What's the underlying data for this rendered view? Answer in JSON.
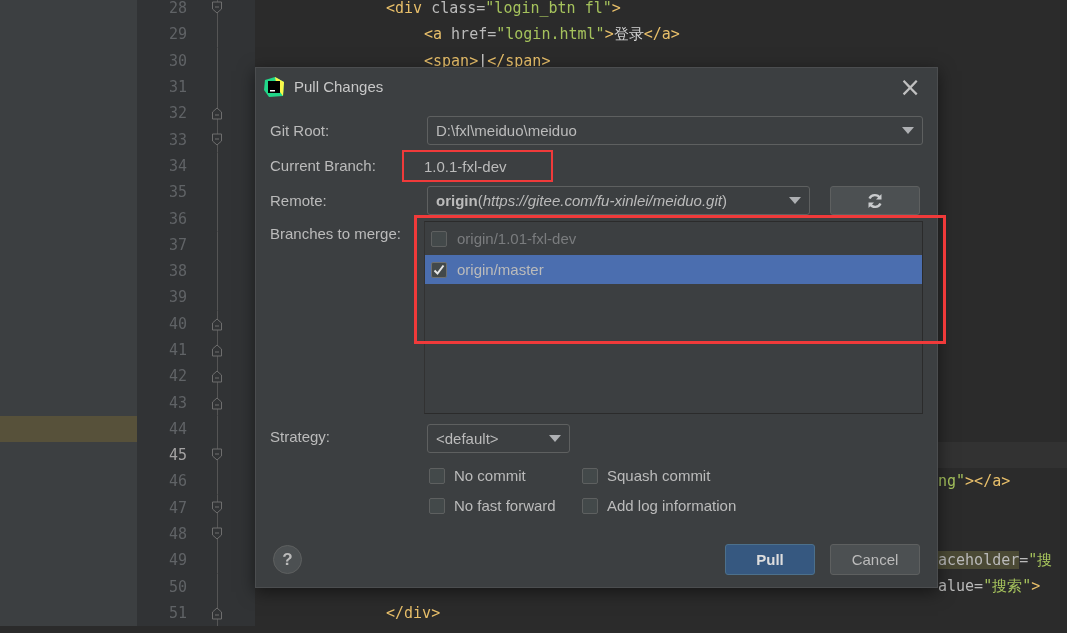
{
  "editor": {
    "lines": [
      {
        "number": "28",
        "kind": "fold-start",
        "current": false,
        "side_highlight": false,
        "segments": [
          {
            "kind": "tag",
            "text": "<div"
          },
          {
            "kind": "attr",
            "text": " class="
          },
          {
            "kind": "string",
            "text": "\"login_btn fl\""
          },
          {
            "kind": "tag",
            "text": ">"
          }
        ],
        "children": [
          {
            "number": "29",
            "current": false,
            "side_highlight": false,
            "segments": [
              {
                "kind": "tag",
                "text": "<a"
              },
              {
                "kind": "attr",
                "text": " href="
              },
              {
                "kind": "string",
                "text": "\"login.html\""
              },
              {
                "kind": "tag",
                "text": ">"
              },
              {
                "kind": "plain",
                "text": "登录"
              },
              {
                "kind": "tag",
                "text": "</a>"
              }
            ]
          },
          {
            "number": "30",
            "current": false,
            "side_highlight": false,
            "segments": [
              {
                "kind": "tag",
                "text": "<span>"
              },
              {
                "kind": "plain",
                "text": "|"
              },
              {
                "kind": "tag",
                "text": "</span>"
              }
            ]
          }
        ]
      },
      {
        "number": "31",
        "kind": "plain",
        "current": false,
        "side_highlight": false
      },
      {
        "number": "32",
        "kind": "fold-end",
        "current": false,
        "side_highlight": false
      },
      {
        "number": "33",
        "kind": "fold-start",
        "current": false,
        "side_highlight": false
      },
      {
        "number": "34",
        "kind": "plain",
        "current": false,
        "side_highlight": false
      },
      {
        "number": "35",
        "kind": "plain",
        "current": false,
        "side_highlight": false
      },
      {
        "number": "36",
        "kind": "plain",
        "current": false,
        "side_highlight": false
      },
      {
        "number": "37",
        "kind": "plain",
        "current": false,
        "side_highlight": false
      },
      {
        "number": "38",
        "kind": "plain",
        "current": false,
        "side_highlight": false
      },
      {
        "number": "39",
        "kind": "plain",
        "current": false,
        "side_highlight": false
      },
      {
        "number": "40",
        "kind": "fold-end",
        "current": false,
        "side_highlight": false
      },
      {
        "number": "41",
        "kind": "fold-end",
        "current": false,
        "side_highlight": false
      },
      {
        "number": "42",
        "kind": "fold-end",
        "current": false,
        "side_highlight": false
      },
      {
        "number": "43",
        "kind": "fold-end",
        "current": false,
        "side_highlight": false
      },
      {
        "number": "44",
        "kind": "plain",
        "current": false,
        "side_highlight": true
      },
      {
        "number": "45",
        "kind": "fold-start",
        "current": true,
        "side_highlight": false
      },
      {
        "number": "46",
        "kind": "plain",
        "current": false,
        "side_highlight": false,
        "tail": [
          {
            "kind": "string",
            "text": "ng\""
          },
          {
            "kind": "tag",
            "text": "></a>"
          }
        ]
      },
      {
        "number": "47",
        "kind": "fold-start",
        "current": false,
        "side_highlight": false
      },
      {
        "number": "48",
        "kind": "fold-start",
        "current": false,
        "side_highlight": false
      },
      {
        "number": "49",
        "kind": "plain",
        "current": false,
        "side_highlight": false,
        "tail": [
          {
            "kind": "attr-marked",
            "text": "aceholder"
          },
          {
            "kind": "attr",
            "text": "="
          },
          {
            "kind": "string",
            "text": "\"搜"
          }
        ]
      },
      {
        "number": "50",
        "kind": "plain",
        "current": false,
        "side_highlight": false,
        "tail": [
          {
            "kind": "attr",
            "text": "alue="
          },
          {
            "kind": "string",
            "text": "\"搜索\""
          },
          {
            "kind": "tag",
            "text": ">"
          }
        ]
      },
      {
        "number": "51",
        "kind": "fold-end",
        "current": false,
        "side_highlight": false,
        "segments": [
          {
            "kind": "tag",
            "text": "</div>"
          }
        ]
      }
    ]
  },
  "dialog": {
    "title": "Pull Changes",
    "close": "×",
    "git_root": {
      "label": "Git Root:",
      "value": "D:\\fxl\\meiduo\\meiduo"
    },
    "current_branch": {
      "label": "Current Branch:",
      "value": "1.0.1-fxl-dev",
      "highlighted": true
    },
    "remote": {
      "label": "Remote:",
      "value": "**origin**(*https://gitee.com/fu-xinlei/meiduo.git*)"
    },
    "branches": {
      "label": "Branches to merge:",
      "highlighted": true,
      "items": [
        {
          "label": "origin/1.01-fxl-dev",
          "checked": false,
          "selected": false,
          "disabled": true
        },
        {
          "label": "origin/master",
          "checked": true,
          "selected": true,
          "disabled": false
        }
      ]
    },
    "strategy": {
      "label": "Strategy:",
      "value": "<default>"
    },
    "options": [
      {
        "label": "No commit",
        "checked": false
      },
      {
        "label": "Squash commit",
        "checked": false
      },
      {
        "label": "No fast forward",
        "checked": false
      },
      {
        "label": "Add log information",
        "checked": false
      }
    ],
    "help": "?",
    "buttons": [
      {
        "label": "Pull",
        "kind": "primary"
      },
      {
        "label": "Cancel",
        "kind": "secondary"
      }
    ]
  }
}
